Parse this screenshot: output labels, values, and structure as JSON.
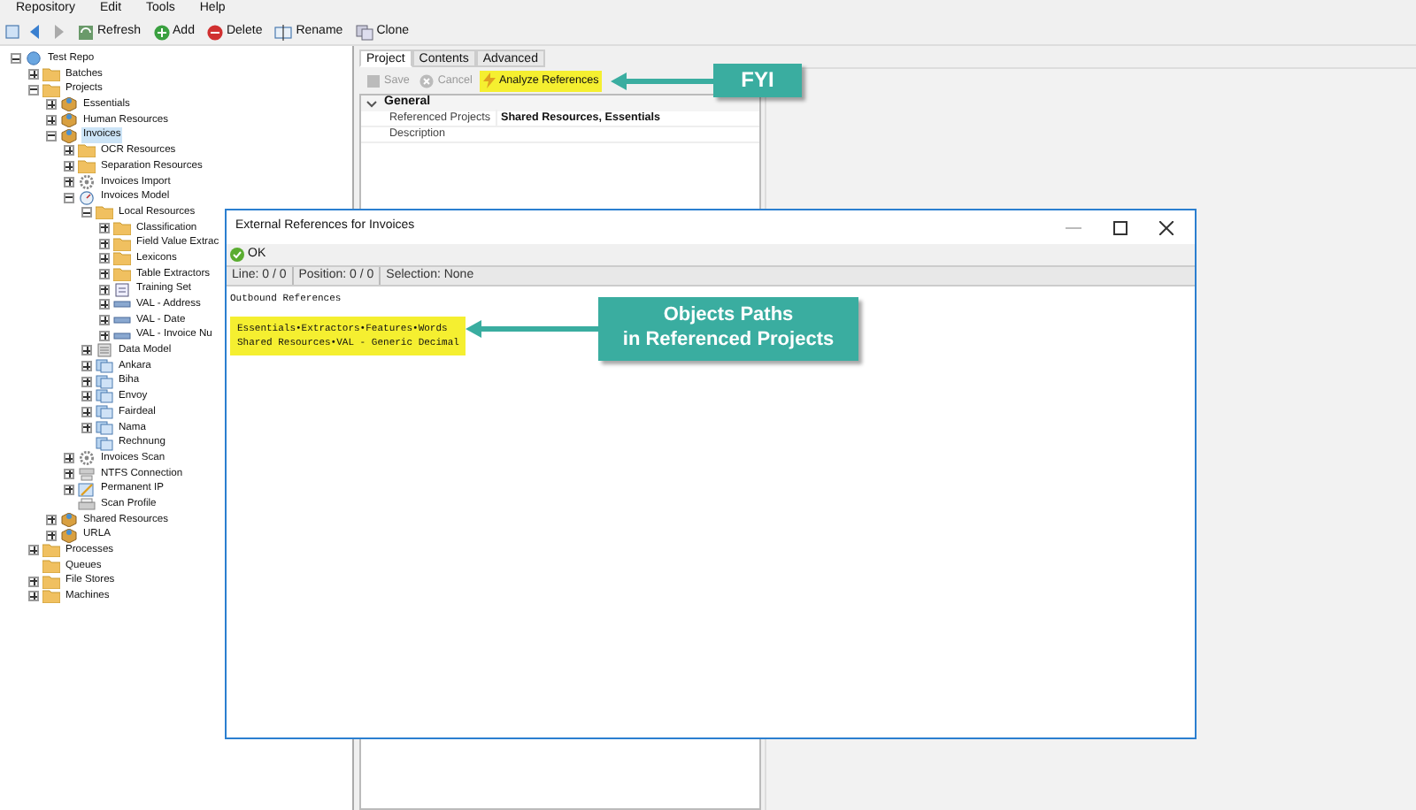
{
  "menu": [
    "Repository",
    "Edit",
    "Tools",
    "Help"
  ],
  "toolbar": [
    {
      "kind": "nav-back"
    },
    {
      "kind": "nav-forward"
    },
    {
      "kind": "refresh",
      "label": "Refresh"
    },
    {
      "kind": "add",
      "label": "Add"
    },
    {
      "kind": "delete",
      "label": "Delete"
    },
    {
      "kind": "rename",
      "label": "Rename"
    },
    {
      "kind": "clone",
      "label": "Clone"
    }
  ],
  "tree": [
    {
      "label": "Test Repo",
      "kind": "repo",
      "expanded": true,
      "selected": false,
      "children": [
        {
          "label": "Batches",
          "kind": "folder",
          "expanded": false,
          "selected": false
        },
        {
          "label": "Projects",
          "kind": "folder",
          "expanded": true,
          "selected": false,
          "children": [
            {
              "label": "Essentials",
              "kind": "project",
              "expanded": false,
              "selected": false
            },
            {
              "label": "Human Resources",
              "kind": "project",
              "expanded": false,
              "selected": false
            },
            {
              "label": "Invoices",
              "kind": "project",
              "expanded": true,
              "selected": true,
              "children": [
                {
                  "label": "OCR Resources",
                  "kind": "folder",
                  "expanded": false,
                  "selected": false
                },
                {
                  "label": "Separation Resources",
                  "kind": "folder",
                  "expanded": false,
                  "selected": false
                },
                {
                  "label": "Invoices Import",
                  "kind": "gear",
                  "expanded": false,
                  "selected": false
                },
                {
                  "label": "Invoices Model",
                  "kind": "model",
                  "expanded": true,
                  "selected": false,
                  "children": [
                    {
                      "label": "Local Resources",
                      "kind": "folder",
                      "expanded": true,
                      "selected": false,
                      "children": [
                        {
                          "label": "Classification",
                          "kind": "folder",
                          "expanded": false,
                          "selected": false
                        },
                        {
                          "label": "Field Value Extrac",
                          "kind": "folder",
                          "expanded": false,
                          "selected": false
                        },
                        {
                          "label": "Lexicons",
                          "kind": "folder",
                          "expanded": false,
                          "selected": false
                        },
                        {
                          "label": "Table Extractors",
                          "kind": "folder",
                          "expanded": false,
                          "selected": false
                        },
                        {
                          "label": "Training Set",
                          "kind": "doc",
                          "expanded": false,
                          "selected": false
                        },
                        {
                          "label": "VAL - Address",
                          "kind": "val",
                          "expanded": false,
                          "selected": false
                        },
                        {
                          "label": "VAL - Date",
                          "kind": "val",
                          "expanded": false,
                          "selected": false
                        },
                        {
                          "label": "VAL - Invoice Nu",
                          "kind": "val",
                          "expanded": false,
                          "selected": false
                        }
                      ]
                    },
                    {
                      "label": "Data Model",
                      "kind": "list",
                      "expanded": false,
                      "selected": false
                    },
                    {
                      "label": "Ankara",
                      "kind": "class",
                      "expanded": false,
                      "selected": false
                    },
                    {
                      "label": "Biha",
                      "kind": "class",
                      "expanded": false,
                      "selected": false
                    },
                    {
                      "label": "Envoy",
                      "kind": "class",
                      "expanded": false,
                      "selected": false
                    },
                    {
                      "label": "Fairdeal",
                      "kind": "class",
                      "expanded": false,
                      "selected": false
                    },
                    {
                      "label": "Nama",
                      "kind": "class",
                      "expanded": false,
                      "selected": false
                    },
                    {
                      "label": "Rechnung",
                      "kind": "class",
                      "selected": false
                    }
                  ]
                },
                {
                  "label": "Invoices Scan",
                  "kind": "gear",
                  "expanded": false,
                  "selected": false
                },
                {
                  "label": "NTFS Connection",
                  "kind": "connection",
                  "expanded": false,
                  "selected": false
                },
                {
                  "label": "Permanent IP",
                  "kind": "edit",
                  "expanded": false,
                  "selected": false
                },
                {
                  "label": "Scan Profile",
                  "kind": "scan",
                  "selected": false
                }
              ]
            },
            {
              "label": "Shared Resources",
              "kind": "project",
              "expanded": false,
              "selected": false
            },
            {
              "label": "URLA",
              "kind": "project",
              "expanded": false,
              "selected": false
            }
          ]
        },
        {
          "label": "Processes",
          "kind": "folder",
          "expanded": false,
          "selected": false
        },
        {
          "label": "Queues",
          "kind": "folder",
          "selected": false
        },
        {
          "label": "File Stores",
          "kind": "folder",
          "expanded": false,
          "selected": false
        },
        {
          "label": "Machines",
          "kind": "folder",
          "expanded": false,
          "selected": false
        }
      ]
    }
  ],
  "tabs": [
    {
      "label": "Project",
      "selected": true
    },
    {
      "label": "Contents",
      "selected": false
    },
    {
      "label": "Advanced",
      "selected": false
    }
  ],
  "panel_toolbar": [
    {
      "kind": "save",
      "label": "Save",
      "disabled": true
    },
    {
      "kind": "cancel",
      "label": "Cancel",
      "disabled": true
    },
    {
      "kind": "analyze",
      "label": "Analyze References",
      "disabled": false
    }
  ],
  "properties": {
    "group": "General",
    "rows": [
      {
        "name": "Referenced Projects",
        "value": "Shared Resources, Essentials"
      },
      {
        "name": "Description"
      }
    ]
  },
  "dialog": {
    "title": "External References for Invoices",
    "ok": "OK",
    "status": [
      "Line: 0 / 0",
      "Position: 0 / 0",
      "Selection: None"
    ],
    "heading": "Outbound References",
    "lines": [
      "Essentials•Extractors•Features•Words",
      "Shared Resources•VAL - Generic Decimal"
    ]
  },
  "callouts": [
    {
      "text": "FYI"
    },
    {
      "text": "Objects Paths\nin Referenced Projects"
    }
  ]
}
